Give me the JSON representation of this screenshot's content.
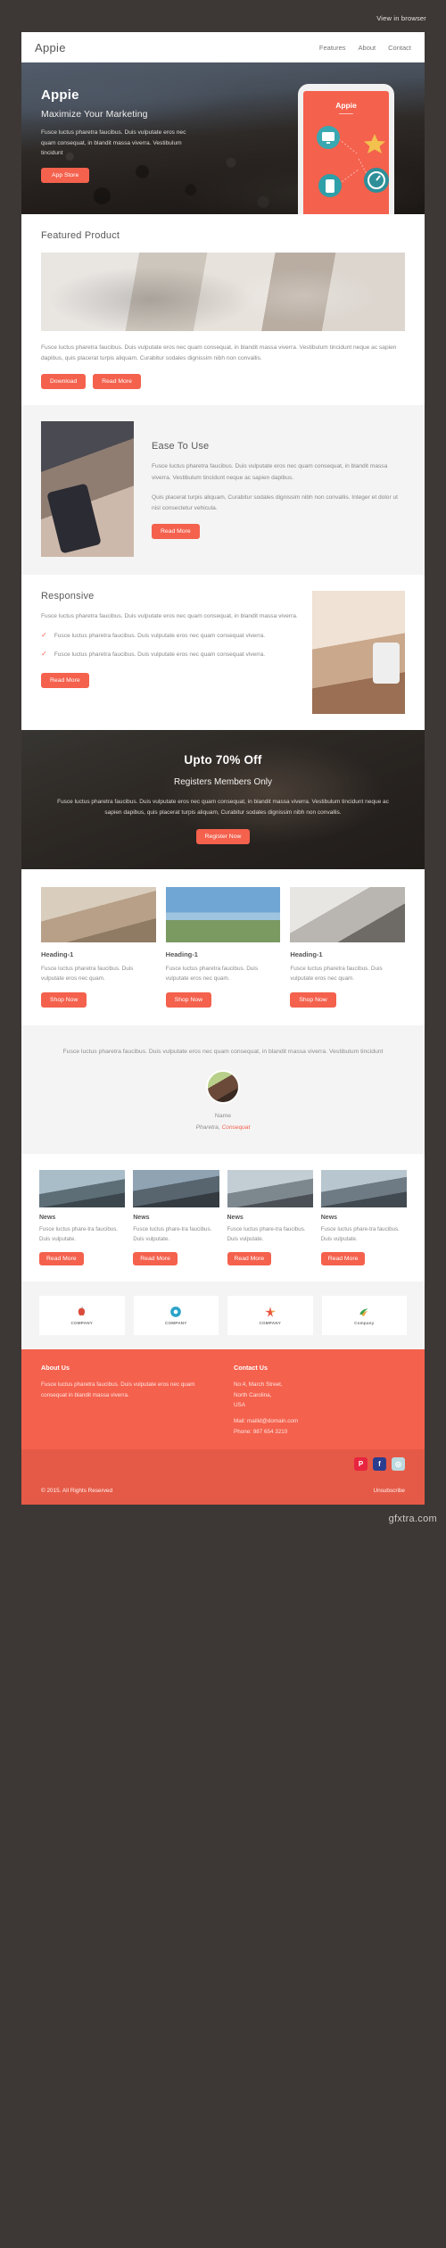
{
  "preheader": {
    "view_in_browser": "View in browser"
  },
  "nav": {
    "brand": "Appie",
    "links": [
      "Features",
      "About",
      "Contact"
    ]
  },
  "hero": {
    "title": "Appie",
    "subtitle": "Maximize Your Marketing",
    "body": "Fusce luctus pharetra faucibus. Duis vulputate eros nec quam consequat, in blandit massa viverra. Vestibulum tincidunt",
    "cta": "App Store",
    "phone_brand": "Appie"
  },
  "featured": {
    "heading": "Featured Product",
    "body": "Fusce luctus pharetra faucibus. Duis vulputate eros nec quam consequat, in blandit massa viverra. Vestibulum tincidunt neque ac sapien dapibus, quis placerat turpis aliquam. Curabitur sodales dignissim nibh non convallis.",
    "btn_primary": "Download",
    "btn_secondary": "Read More"
  },
  "ease": {
    "heading": "Ease To Use",
    "body1": "Fusce luctus pharetra faucibus. Duis vulputate eros nec quam consequat, in blandit massa viverra. Vestibulum tincidunt neque ac sapien dapibus.",
    "body2": "Quis placerat turpis aliquam, Curabitur sodales dignissim nibh non convallis. Integer et dolor ut nisl consectetur vehicula.",
    "cta": "Read More"
  },
  "responsive": {
    "heading": "Responsive",
    "body": "Fusce luctus pharetra faucibus. Duis vulputate eros nec quam consequat, in blandit massa viverra.",
    "bullets": [
      "Fusce luctus pharetra faucibus. Duis vulputate eros nec quam consequat viverra.",
      "Fusce luctus pharetra faucibus. Duis vulputate eros nec quam consequat viverra."
    ],
    "cta": "Read More"
  },
  "promo": {
    "heading": "Upto 70% Off",
    "subheading": "Registers Members Only",
    "body": "Fusce luctus pharetra faucibus. Duis vulputate eros nec quam consequat, in blandit massa viverra. Vestibulum tincidunt neque ac sapien dapibus, quis placerat turpis aliquam, Curabitur sodales dignissim nibh non convallis.",
    "cta": "Register Now"
  },
  "cards": [
    {
      "heading": "Heading-1",
      "body": "Fusce luctus pharetra faucibus. Duis vulputate eros nec quam.",
      "cta": "Shop Now"
    },
    {
      "heading": "Heading-1",
      "body": "Fusce luctus pharetra faucibus. Duis vulputate eros nec quam.",
      "cta": "Shop Now"
    },
    {
      "heading": "Heading-1",
      "body": "Fusce luctus pharetra faucibus. Duis vulputate eros nec quam.",
      "cta": "Shop Now"
    }
  ],
  "testimonial": {
    "quote": "Fusce luctus pharetra faucibus. Duis vulputate eros nec quam consequat, in blandit massa viverra. Vestibulum tincidunt",
    "name": "Name",
    "role_prefix": "Pharetra, ",
    "role_accent": "Consequat"
  },
  "news": [
    {
      "heading": "News",
      "body": "Fusce luctus phare-tra faucibus. Duis vulputate.",
      "cta": "Read More"
    },
    {
      "heading": "News",
      "body": "Fusce luctus phare-tra faucibus. Duis vulputate.",
      "cta": "Read More"
    },
    {
      "heading": "News",
      "body": "Fusce luctus phare-tra faucibus. Duis vulputate.",
      "cta": "Read More"
    },
    {
      "heading": "News",
      "body": "Fusce luctus phare-tra faucibus. Duis vulputate.",
      "cta": "Read More"
    }
  ],
  "logos": [
    {
      "name": "COMPANY"
    },
    {
      "name": "COMPANY"
    },
    {
      "name": "COMPANY"
    },
    {
      "name": "Company"
    }
  ],
  "footer": {
    "about_title": "About Us",
    "about_body": "Fusce luctus pharetra faucibus. Duis vulputate eros nec quam consequat in blandit massa viverra.",
    "contact_title": "Contact Us",
    "address_line1": "No:4, March Street,",
    "address_line2": "North Carolina,",
    "address_line3": "USA",
    "mail": "Mail: mailid@domain.com",
    "phone": "Phone: 987 654 3210",
    "social": [
      "pinterest-icon",
      "facebook-icon",
      "dribbble-icon"
    ],
    "copyright": "© 2015. All Rights Reserved",
    "unsubscribe": "Unsubscribe"
  },
  "watermark": {
    "text": "gfxtra.com"
  },
  "colors": {
    "accent": "#f4614d",
    "accent_dark": "#e55a47",
    "page_bg": "#3d3835"
  }
}
